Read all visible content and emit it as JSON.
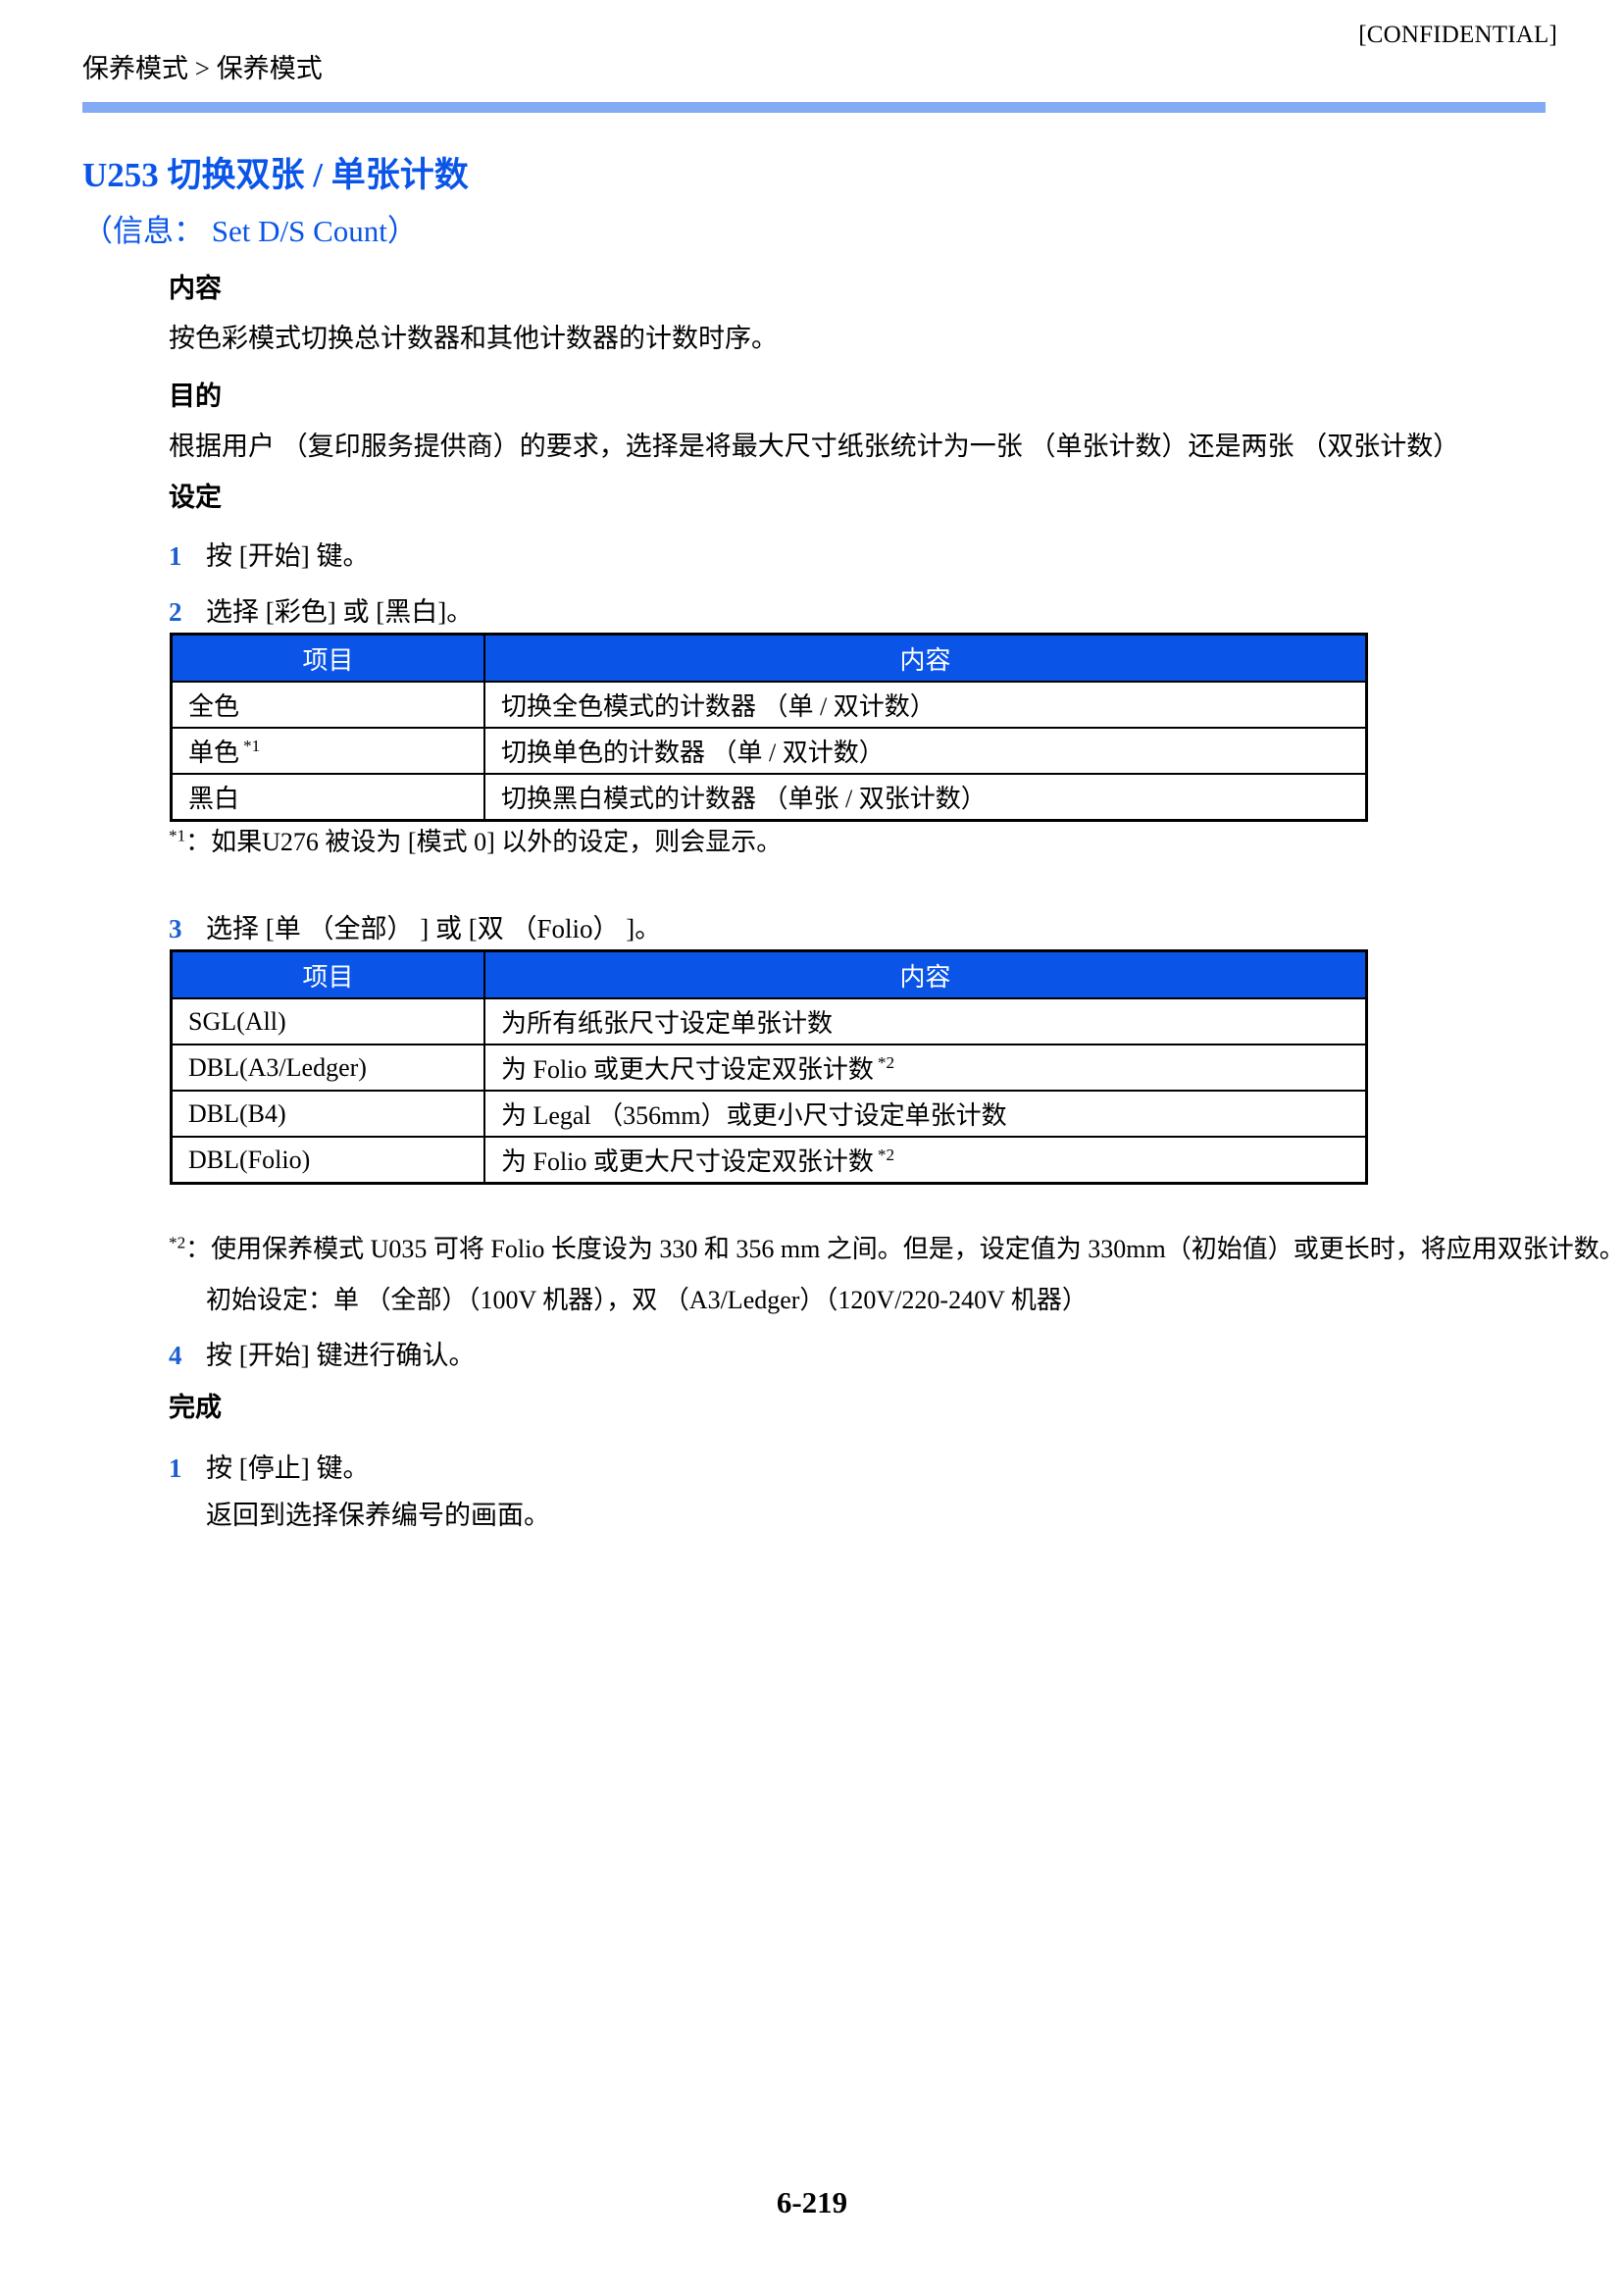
{
  "header": {
    "confidential": "[CONFIDENTIAL]",
    "breadcrumb": "保养模式 > 保养模式"
  },
  "section": {
    "title": "U253 切换双张 / 单张计数",
    "subtitle": "（信息： Set D/S Count）"
  },
  "blocks": {
    "description_head": "内容",
    "description_text": "按色彩模式切换总计数器和其他计数器的计数时序。",
    "purpose_head": "目的",
    "purpose_text": "根据用户 （复印服务提供商）的要求，选择是将最大尺寸纸张统计为一张 （单张计数）还是两张 （双张计数）",
    "setting_head": "设定",
    "completion_head": "完成"
  },
  "steps": {
    "s1_num": "1",
    "s1_text": "按 [开始] 键。",
    "s2_num": "2",
    "s2_text": "选择 [彩色] 或 [黑白]。",
    "s3_num": "3",
    "s3_text": "选择 [单 （全部） ] 或 [双 （Folio） ]。",
    "s4_num": "4",
    "s4_text": "按 [开始] 键进行确认。",
    "f1_num": "1",
    "f1_text": "按 [停止] 键。",
    "f1_sub": "返回到选择保养编号的画面。"
  },
  "table1": {
    "headers": [
      "项目",
      "内容"
    ],
    "rows": [
      {
        "item": "全色",
        "item_sup": "",
        "desc": "切换全色模式的计数器 （单 / 双计数）",
        "desc_sup": ""
      },
      {
        "item": "单色",
        "item_sup": "*1",
        "desc": "切换单色的计数器 （单 / 双计数）",
        "desc_sup": ""
      },
      {
        "item": "黑白",
        "item_sup": "",
        "desc": "切换黑白模式的计数器 （单张 / 双张计数）",
        "desc_sup": ""
      }
    ]
  },
  "footnote1": {
    "mark": "*1",
    "text": "：如果U276 被设为 [模式 0] 以外的设定，则会显示。"
  },
  "table2": {
    "headers": [
      "项目",
      "内容"
    ],
    "rows": [
      {
        "item": "SGL(All)",
        "item_sup": "",
        "desc": "为所有纸张尺寸设定单张计数",
        "desc_sup": ""
      },
      {
        "item": "DBL(A3/Ledger)",
        "item_sup": "",
        "desc": "为 Folio 或更大尺寸设定双张计数",
        "desc_sup": "*2"
      },
      {
        "item": "DBL(B4)",
        "item_sup": "",
        "desc": "为 Legal （356mm）或更小尺寸设定单张计数",
        "desc_sup": ""
      },
      {
        "item": "DBL(Folio)",
        "item_sup": "",
        "desc": "为 Folio 或更大尺寸设定双张计数",
        "desc_sup": "*2"
      }
    ]
  },
  "footnote2": {
    "mark": "*2",
    "text": "：使用保养模式 U035 可将 Folio 长度设为 330 和 356 mm 之间。但是，设定值为 330mm（初始值）或更长时，将应用双张计数。",
    "continuation": "初始设定：单 （全部）（100V 机器），双 （A3/Ledger）（120V/220-240V 机器）"
  },
  "footer": {
    "page_number": "6-219"
  }
}
